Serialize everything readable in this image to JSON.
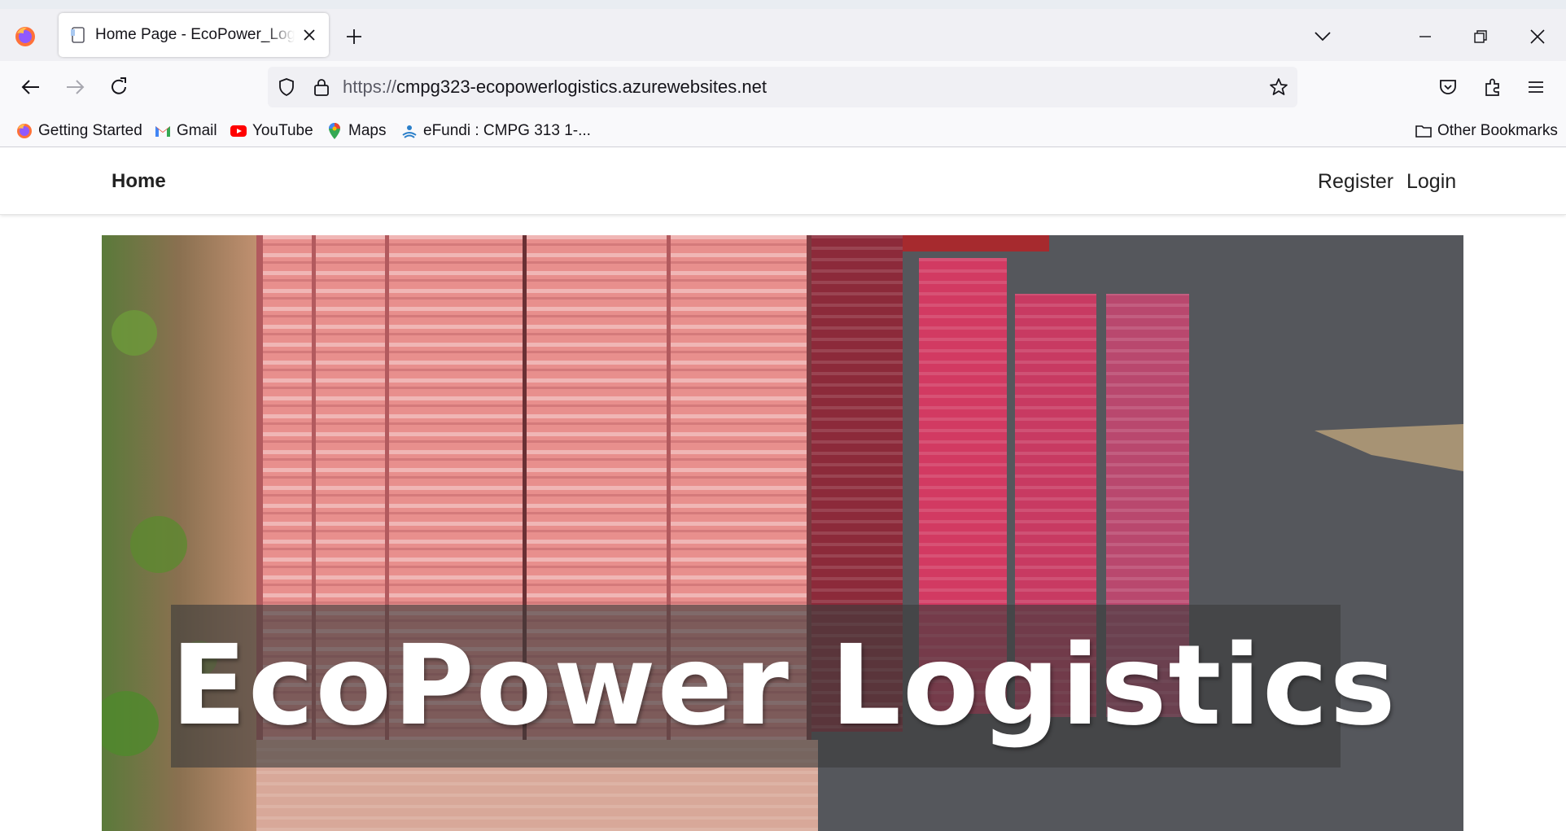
{
  "browser": {
    "tab_title": "Home Page - EcoPower_Logistics",
    "url_scheme": "https://",
    "url_host": "cmpg323-ecopowerlogistics.azurewebsites.net",
    "bookmarks": [
      {
        "label": "Getting Started",
        "icon": "firefox-icon"
      },
      {
        "label": "Gmail",
        "icon": "gmail-icon"
      },
      {
        "label": "YouTube",
        "icon": "youtube-icon"
      },
      {
        "label": "Maps",
        "icon": "maps-icon"
      },
      {
        "label": "eFundi : CMPG 313 1-...",
        "icon": "efundi-icon"
      }
    ],
    "other_bookmarks": "Other Bookmarks"
  },
  "site": {
    "nav": {
      "home": "Home",
      "register": "Register",
      "login": "Login"
    },
    "hero": {
      "title": "EcoPower Logistics",
      "image": "aerial view of shipping containers"
    }
  },
  "colors": {
    "accent": "#0060df",
    "container_red": "#d9566a",
    "asphalt": "#55575c"
  }
}
